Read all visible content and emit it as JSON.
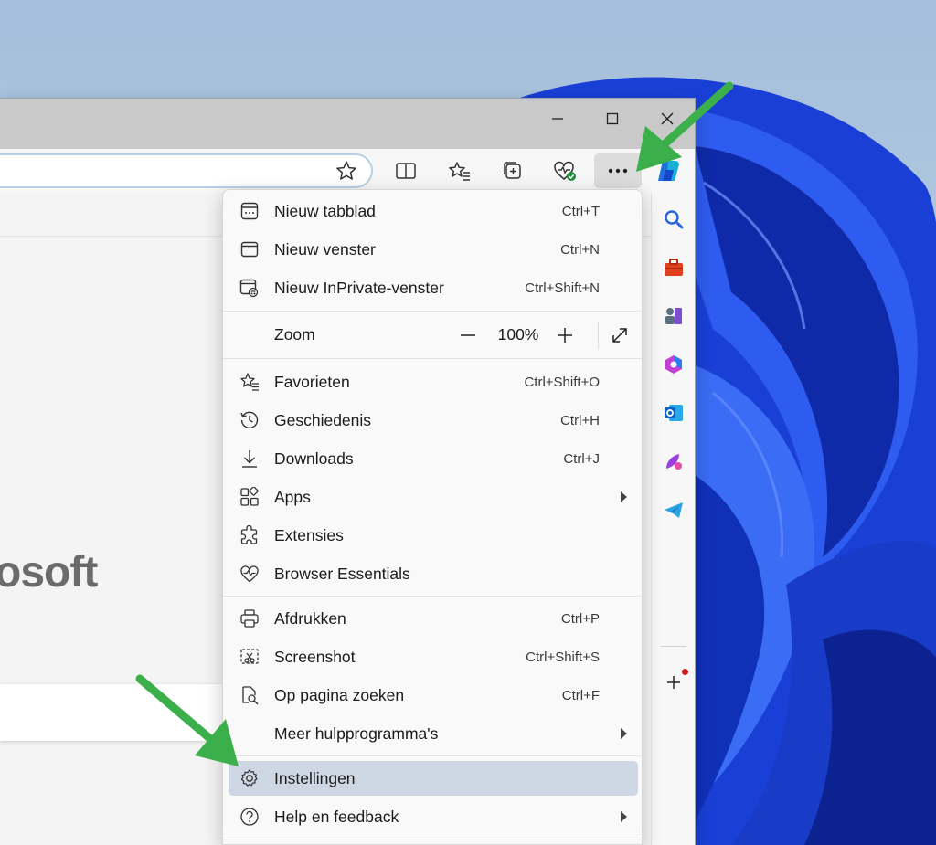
{
  "accent_color": "#2b63d9",
  "arrow_color": "#3bb04a",
  "page": {
    "brand_fragment": "osoft"
  },
  "window_controls": [
    {
      "name": "minimize-icon"
    },
    {
      "name": "maximize-icon"
    },
    {
      "name": "close-icon"
    }
  ],
  "toolbar_icons": [
    "favorite-star-icon",
    "split-screen-icon",
    "favorites-icon",
    "collections-icon",
    "browser-essentials-icon",
    "more-icon",
    "copilot-icon"
  ],
  "sidebar_icons": [
    "search-icon",
    "tools-icon",
    "games-icon",
    "microsoft365-icon",
    "outlook-icon",
    "designer-icon",
    "telegram-icon",
    "add-icon"
  ],
  "menu": {
    "items": [
      {
        "label": "Nieuw tabblad",
        "shortcut": "Ctrl+T",
        "icon": "new-tab-icon"
      },
      {
        "label": "Nieuw venster",
        "shortcut": "Ctrl+N",
        "icon": "new-window-icon"
      },
      {
        "label": "Nieuw InPrivate-venster",
        "shortcut": "Ctrl+Shift+N",
        "icon": "inprivate-icon"
      }
    ],
    "zoom": {
      "label": "Zoom",
      "value": "100%"
    },
    "items2": [
      {
        "label": "Favorieten",
        "shortcut": "Ctrl+Shift+O",
        "icon": "favorites-icon"
      },
      {
        "label": "Geschiedenis",
        "shortcut": "Ctrl+H",
        "icon": "history-icon"
      },
      {
        "label": "Downloads",
        "shortcut": "Ctrl+J",
        "icon": "download-icon"
      },
      {
        "label": "Apps",
        "shortcut": "",
        "icon": "apps-icon",
        "submenu": true
      },
      {
        "label": "Extensies",
        "shortcut": "",
        "icon": "extensions-icon"
      },
      {
        "label": "Browser Essentials",
        "shortcut": "",
        "icon": "browser-essentials-icon"
      }
    ],
    "items3": [
      {
        "label": "Afdrukken",
        "shortcut": "Ctrl+P",
        "icon": "print-icon"
      },
      {
        "label": "Screenshot",
        "shortcut": "Ctrl+Shift+S",
        "icon": "screenshot-icon"
      },
      {
        "label": "Op pagina zoeken",
        "shortcut": "Ctrl+F",
        "icon": "find-on-page-icon"
      },
      {
        "label": "Meer hulpprogramma's",
        "shortcut": "",
        "icon": "",
        "submenu": true
      }
    ],
    "items4": [
      {
        "label": "Instellingen",
        "shortcut": "",
        "icon": "settings-icon",
        "highlighted": true
      },
      {
        "label": "Help en feedback",
        "shortcut": "",
        "icon": "help-icon",
        "submenu": true
      }
    ]
  }
}
